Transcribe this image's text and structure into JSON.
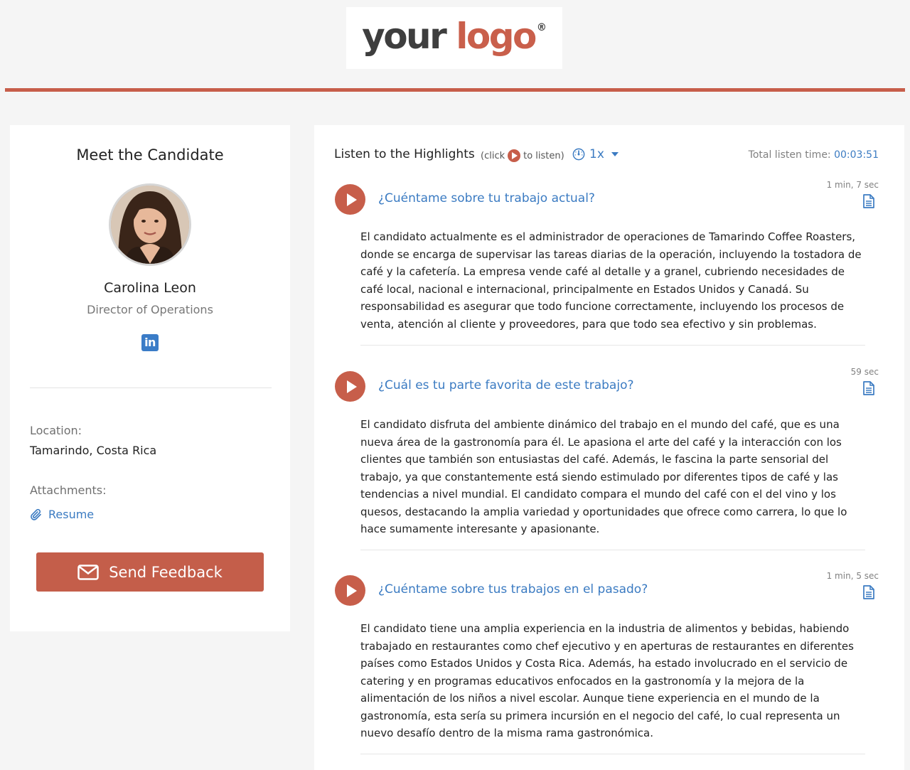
{
  "header": {
    "logo_your": "your",
    "logo_logo": "logo",
    "logo_reg": "®"
  },
  "candidate": {
    "section_title": "Meet the Candidate",
    "name": "Carolina Leon",
    "role": "Director of Operations",
    "linkedin_glyph": "in",
    "location_label": "Location:",
    "location_value": "Tamarindo, Costa Rica",
    "attachments_label": "Attachments:",
    "resume_label": "Resume",
    "feedback_label": "Send Feedback"
  },
  "highlights": {
    "title": "Listen to the Highlights",
    "hint_before": "(click",
    "hint_after": "to listen)",
    "speed": "1x",
    "total_label": "Total listen time: ",
    "total_time": "00:03:51",
    "items": [
      {
        "question": "¿Cuéntame sobre tu trabajo actual?",
        "duration": "1 min, 7 sec",
        "answer": "El candidato actualmente es el administrador de operaciones de Tamarindo Coffee Roasters, donde se encarga de supervisar las tareas diarias de la operación, incluyendo la tostadora de café y la cafetería. La empresa vende café al detalle y a granel, cubriendo necesidades de café local, nacional e internacional, principalmente en Estados Unidos y Canadá. Su responsabilidad es asegurar que todo funcione correctamente, incluyendo los procesos de venta, atención al cliente y proveedores, para que todo sea efectivo y sin problemas."
      },
      {
        "question": "¿Cuál es tu parte favorita de este trabajo?",
        "duration": "59 sec",
        "answer": "El candidato disfruta del ambiente dinámico del trabajo en el mundo del café, que es una nueva área de la gastronomía para él. Le apasiona el arte del café y la interacción con los clientes que también son entusiastas del café. Además, le fascina la parte sensorial del trabajo, ya que constantemente está siendo estimulado por diferentes tipos de café y las tendencias a nivel mundial. El candidato compara el mundo del café con el del vino y los quesos, destacando la amplia variedad y oportunidades que ofrece como carrera, lo que lo hace sumamente interesante y apasionante."
      },
      {
        "question": "¿Cuéntame sobre tus trabajos en el pasado?",
        "duration": "1 min, 5 sec",
        "answer": "El candidato tiene una amplia experiencia en la industria de alimentos y bebidas, habiendo trabajado en restaurantes como chef ejecutivo y en aperturas de restaurantes en diferentes países como Estados Unidos y Costa Rica. Además, ha estado involucrado en el servicio de catering y en programas educativos enfocados en la gastronomía y la mejora de la alimentación de los niños a nivel escolar. Aunque tiene experiencia en el mundo de la gastronomía, esta sería su primera incursión en el negocio del café, lo cual representa un nuevo desafío dentro de la misma rama gastronómica."
      }
    ]
  },
  "colors": {
    "accent": "#c75e4a",
    "link": "#3b7bc2",
    "background": "#f5f5f5"
  },
  "icons": [
    "play-icon",
    "speed-gauge-icon",
    "chevron-down-icon",
    "document-icon",
    "linkedin-icon",
    "paperclip-icon",
    "envelope-icon"
  ]
}
